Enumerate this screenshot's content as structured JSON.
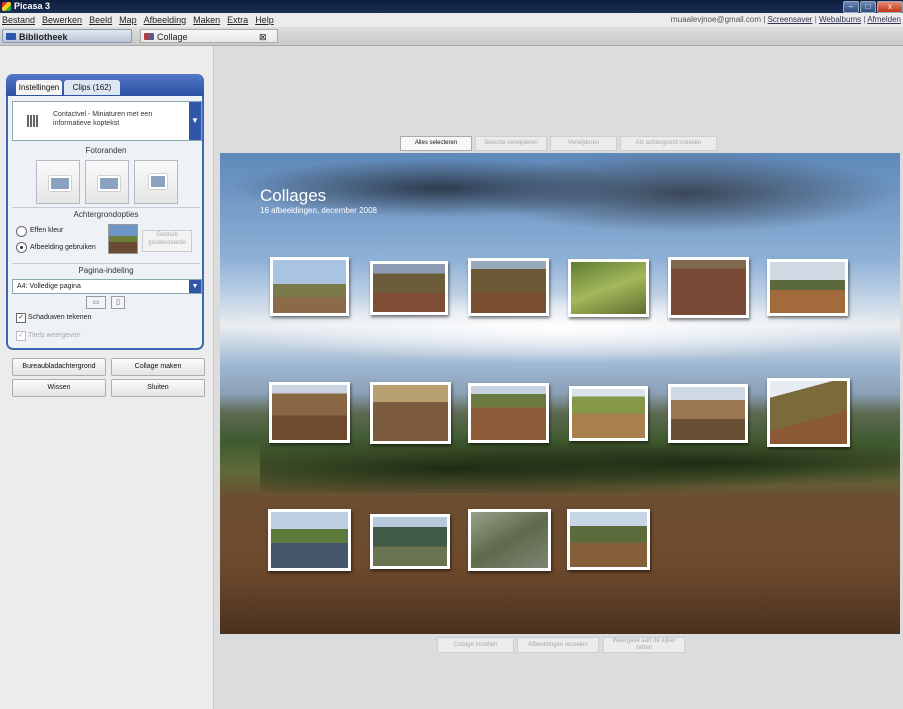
{
  "window": {
    "title": "Picasa 3",
    "buttons": [
      "–",
      "□",
      "x"
    ]
  },
  "menu": [
    "Bestand",
    "Bewerken",
    "Beeld",
    "Map",
    "Afbeelding",
    "Maken",
    "Extra",
    "Help"
  ],
  "top_links": {
    "email": "rnuaalevjnoe@gmail.com",
    "links": [
      "Screensaver",
      "Webalbums",
      "Afmelden"
    ]
  },
  "tabs": {
    "library": "Bibliotheek",
    "collage": "Collage",
    "close": "⊠"
  },
  "panel": {
    "tab_settings": "Instellingen",
    "tab_clips": "Clips (162)",
    "layout_text": "Contactvel - Miniaturen met een informatieve koptekst",
    "section_frames": "Fotoranden",
    "section_background": "Achtergrondopties",
    "radio_solid": "Effen kleur",
    "radio_image": "Afbeelding gebruiken",
    "choose_bg": "Gebruik geselecteerde",
    "section_page": "Pagina-indeling",
    "page_value": "A4: Volledige pagina",
    "check_shadows": "Schaduwen tekenen",
    "check_captions": "Titels weergeven"
  },
  "actions": {
    "desktop_bg": "Bureaubladachtergrond",
    "make_collage": "Collage maken",
    "clear": "Wissen",
    "close": "Sluiten"
  },
  "toolbar": [
    "Alles selecteren",
    "Selectie verwijderen",
    "Verwijderen",
    "Als achtergrond instellen"
  ],
  "collage": {
    "title": "Collages",
    "subtitle": "16 afbeeldingen, december 2008"
  },
  "bottom_bar": [
    "Collage instellen",
    "Afbeeldingen wisselen",
    "Weergave aan de kijker zetten"
  ],
  "colors": {
    "panel_border": "#3f66b3",
    "titlebar": "#0d1d3d",
    "accent": "#2f56a8"
  }
}
